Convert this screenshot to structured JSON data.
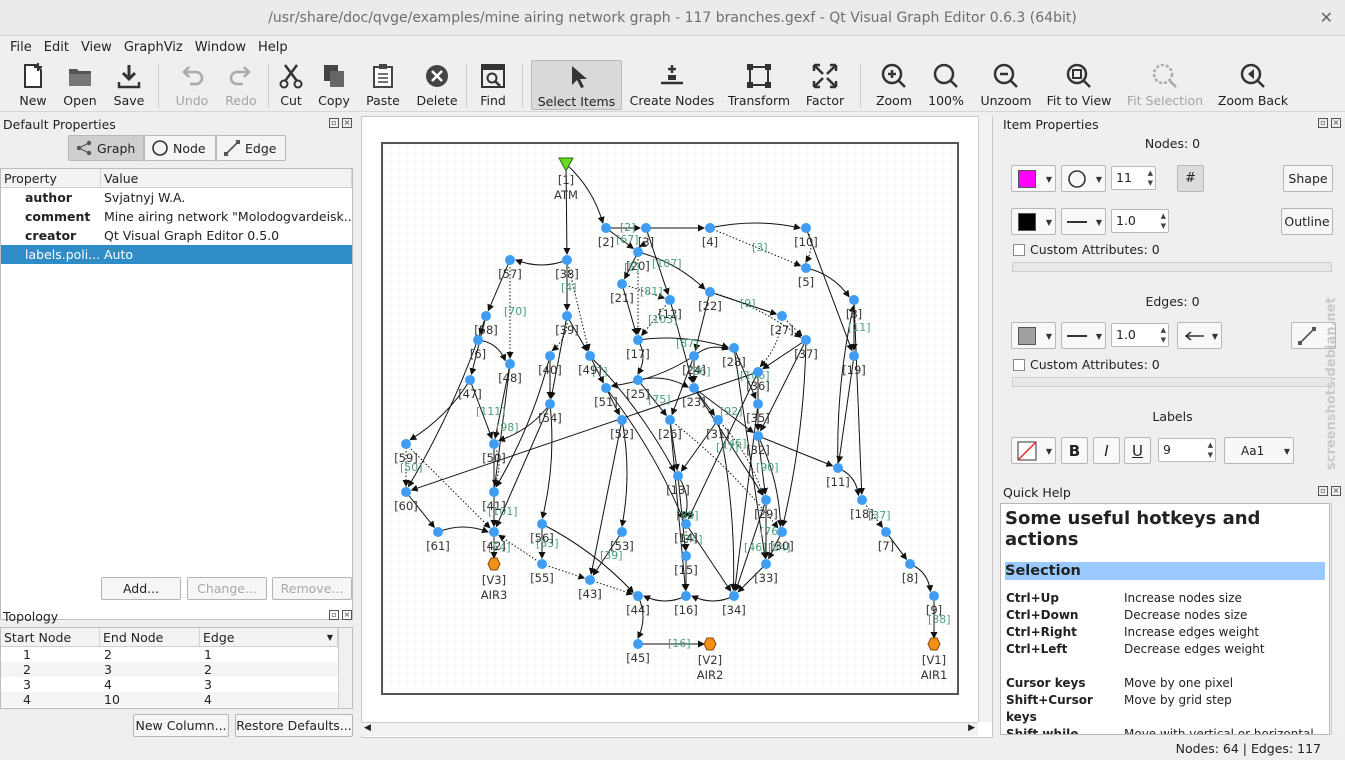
{
  "window": {
    "title": "/usr/share/doc/qvge/examples/mine airing network graph - 117 branches.gexf - Qt Visual Graph Editor 0.6.3 (64bit)",
    "close": "✕"
  },
  "menu": [
    "File",
    "Edit",
    "View",
    "GraphViz",
    "Window",
    "Help"
  ],
  "toolbar": {
    "new": "New",
    "open": "Open",
    "save": "Save",
    "undo": "Undo",
    "redo": "Redo",
    "cut": "Cut",
    "copy": "Copy",
    "paste": "Paste",
    "delete": "Delete",
    "find": "Find",
    "select": "Select Items",
    "create": "Create Nodes",
    "transform": "Transform",
    "factor": "Factor",
    "zoom": "Zoom",
    "zoom100": "100%",
    "unzoom": "Unzoom",
    "fit": "Fit to View",
    "fitsel": "Fit Selection",
    "zoomback": "Zoom Back"
  },
  "defaults": {
    "title": "Default Properties",
    "tabs": {
      "graph": "Graph",
      "node": "Node",
      "edge": "Edge"
    },
    "columns": {
      "property": "Property",
      "value": "Value"
    },
    "rows": [
      {
        "k": "author",
        "v": "Svjatnyj W.A."
      },
      {
        "k": "comment",
        "v": "Mine airing network \"Molodogvardeisk..."
      },
      {
        "k": "creator",
        "v": "Qt Visual Graph Editor 0.5.0"
      },
      {
        "k": "labels.poli...",
        "v": "Auto"
      }
    ],
    "add": "Add...",
    "change": "Change...",
    "remove": "Remove..."
  },
  "topology": {
    "title": "Topology",
    "columns": {
      "start": "Start Node",
      "end": "End Node",
      "edge": "Edge"
    },
    "rows": [
      {
        "s": "1",
        "e": "2",
        "g": "1"
      },
      {
        "s": "2",
        "e": "3",
        "g": "2"
      },
      {
        "s": "3",
        "e": "4",
        "g": "3"
      },
      {
        "s": "4",
        "e": "10",
        "g": "4"
      }
    ],
    "new_column": "New Column...",
    "restore": "Restore Defaults..."
  },
  "item_props": {
    "title": "Item Properties",
    "nodes": "Nodes: 0",
    "node_size": "11",
    "hash": "#",
    "shape": "Shape",
    "stroke_width": "1.0",
    "outline": "Outline",
    "custom_attrs": "Custom Attributes: 0",
    "edges": "Edges: 0",
    "edge_width": "1.0",
    "edge_custom_attrs": "Custom Attributes: 0",
    "labels": "Labels",
    "bold": "B",
    "italic": "I",
    "underline": "U",
    "font_size": "9",
    "case": "Aa1",
    "node_color": "#ff00ff",
    "stroke_color": "#000000",
    "edge_color": "#a0a0a0"
  },
  "quick_help": {
    "title": "Quick Help",
    "heading": "Some useful hotkeys and actions",
    "section": "Selection",
    "items": [
      {
        "k": "Ctrl+Up",
        "v": "Increase nodes size"
      },
      {
        "k": "Ctrl+Down",
        "v": "Decrease nodes size"
      },
      {
        "k": "Ctrl+Right",
        "v": "Increase edges weight"
      },
      {
        "k": "Ctrl+Left",
        "v": "Decrease edges weight"
      },
      {
        "k": "Cursor keys",
        "v": "Move by one pixel"
      },
      {
        "k": "Shift+Cursor keys",
        "v": "Move by grid step"
      },
      {
        "k": "Shift while",
        "v": "Move with vertical or horizontal"
      }
    ]
  },
  "status": "Nodes: 64 | Edges: 117",
  "watermark": "screenshots.debian.net",
  "graph": {
    "node_color": "#3f9ef4",
    "special": [
      {
        "id": "1",
        "label": "[1]",
        "sub": "ATM"
      },
      {
        "id": "V1",
        "label": "[V1]",
        "sub": "AIR1"
      },
      {
        "id": "V2",
        "label": "[V2]",
        "sub": "AIR2"
      },
      {
        "id": "V3",
        "label": "[V3]",
        "sub": "AIR3"
      }
    ],
    "node_labels": [
      "[2]",
      "[3]",
      "[4]",
      "[10]",
      "[5]",
      "[57]",
      "[38]",
      "[20]",
      "[21]",
      "[12]",
      "[22]",
      "[8]",
      "[27]",
      "[37]",
      "[58]",
      "[39]",
      "[17]",
      "[24]",
      "[28]",
      "[36]",
      "[47]",
      "[48]",
      "[40]",
      "[49]",
      "[51]",
      "[25]",
      "[23]",
      "[35]",
      "[32]",
      "[54]",
      "[52]",
      "[26]",
      "[31]",
      "[19]",
      "[59]",
      "[50]",
      "[13]",
      "[11]",
      "[60]",
      "[41]",
      "[14]",
      "[29]",
      "[18]",
      "[61]",
      "[42]",
      "[56]",
      "[53]",
      "[15]",
      "[30]",
      "[7]",
      "[55]",
      "[43]",
      "[33]",
      "[8]",
      "[44]",
      "[16]",
      "[34]",
      "[9]",
      "[45]",
      "[6]"
    ],
    "edge_labels": [
      "[2]",
      "[3]",
      "[4]",
      "[5]",
      "[9]",
      "[11]",
      "[37]",
      "[38]",
      "[7]",
      "[39]",
      "[16]",
      "[50]",
      "[54]",
      "[101]",
      "[53]",
      "[75]",
      "[74]",
      "[86]",
      "[76]",
      "[106]",
      "[84]",
      "[103]",
      "[87]",
      "[107]",
      "[98]",
      "[92]",
      "[81]",
      "[90]",
      "[88]",
      "[77]",
      "[111]",
      "[70]",
      "[46]",
      "[45]",
      "[67]"
    ]
  }
}
